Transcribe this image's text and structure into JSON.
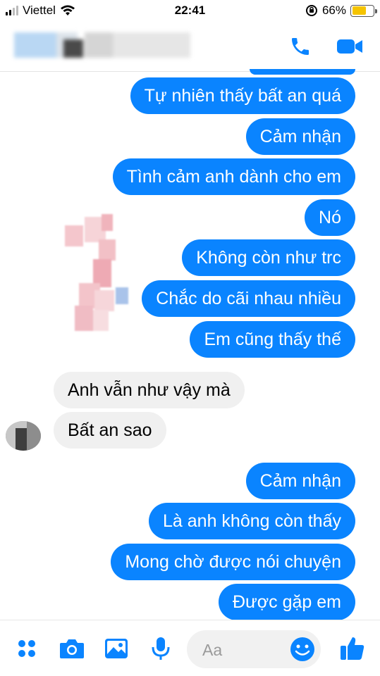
{
  "status_bar": {
    "carrier": "Viettel",
    "time": "22:41",
    "battery_percent": "66%",
    "battery_level": 0.66
  },
  "header": {
    "contact_name_blurred": true,
    "accent_color": "#0a84ff"
  },
  "messages": [
    {
      "direction": "out",
      "text": "Tự nhiên thấy bất an quá"
    },
    {
      "direction": "out",
      "text": "Cảm nhận"
    },
    {
      "direction": "out",
      "text": "Tình cảm anh dành cho em"
    },
    {
      "direction": "out",
      "text": "Nó"
    },
    {
      "direction": "out",
      "text": "Không còn như trc"
    },
    {
      "direction": "out",
      "text": "Chắc do cãi nhau nhiều"
    },
    {
      "direction": "out",
      "text": "Em cũng thấy thế"
    },
    {
      "direction": "in",
      "text": "Anh vẫn như vậy mà"
    },
    {
      "direction": "in",
      "text": "Bất an sao"
    },
    {
      "direction": "out",
      "text": "Cảm nhận"
    },
    {
      "direction": "out",
      "text": "Là anh không còn thấy"
    },
    {
      "direction": "out",
      "text": "Mong chờ được nói chuyện"
    },
    {
      "direction": "out",
      "text": "Được gặp em"
    }
  ],
  "composer": {
    "placeholder": "Aa",
    "icons": [
      "apps-icon",
      "camera-icon",
      "gallery-icon",
      "microphone-icon",
      "emoji-icon",
      "thumbs-up-icon"
    ]
  }
}
